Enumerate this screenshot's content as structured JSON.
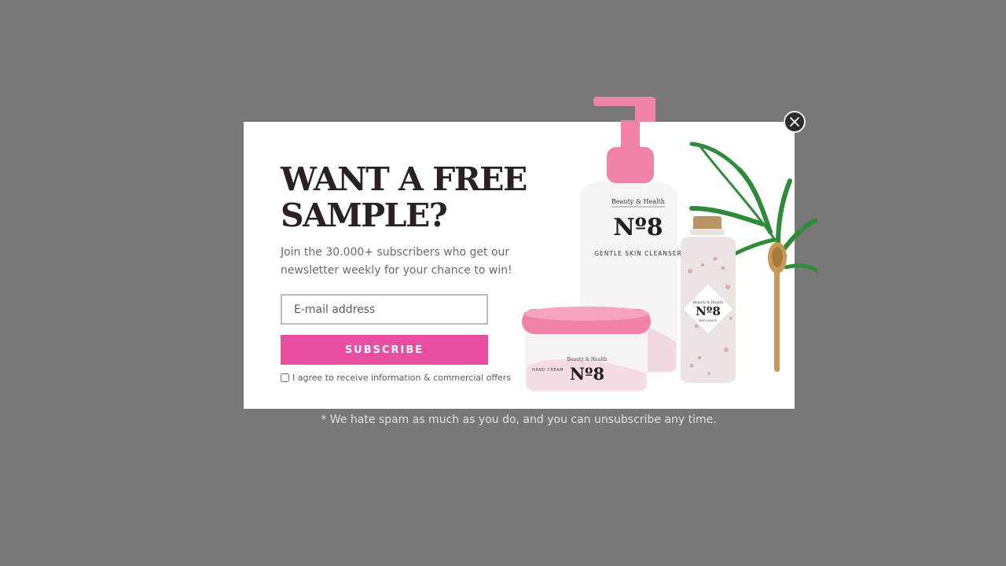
{
  "popup": {
    "headline": "WANT A FREE SAMPLE?",
    "subtitle": "Join the 30.000+ subscribers who get our newsletter weekly for your chance to win!",
    "email_placeholder": "E-mail address",
    "subscribe_label": "SUBSCRIBE",
    "agree_label": "I agree to receive information & commercial offers"
  },
  "products": {
    "brand": "Beauty & Health",
    "number": "Nº8",
    "bottle_label": "GENTLE SKIN CLEANSER",
    "jar_label": "HAND CREAM",
    "salts_label": "BATH SALTS"
  },
  "footnote": "* We hate spam as much as you do, and you can unsubscribe any time.",
  "colors": {
    "backdrop": "#787878",
    "accent": "#e94fa0",
    "headline": "#2b2024",
    "close_button": "#2b2b2b"
  },
  "icons": {
    "close": "close-icon"
  }
}
